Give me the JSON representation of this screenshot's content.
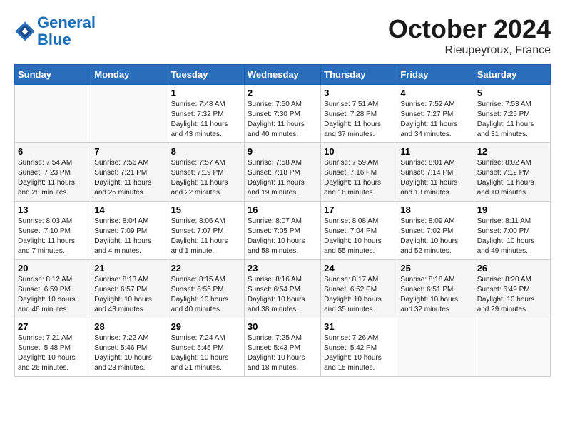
{
  "header": {
    "logo_line1": "General",
    "logo_line2": "Blue",
    "month": "October 2024",
    "location": "Rieupeyroux, France"
  },
  "weekdays": [
    "Sunday",
    "Monday",
    "Tuesday",
    "Wednesday",
    "Thursday",
    "Friday",
    "Saturday"
  ],
  "weeks": [
    [
      {
        "day": "",
        "sunrise": "",
        "sunset": "",
        "daylight": ""
      },
      {
        "day": "",
        "sunrise": "",
        "sunset": "",
        "daylight": ""
      },
      {
        "day": "1",
        "sunrise": "Sunrise: 7:48 AM",
        "sunset": "Sunset: 7:32 PM",
        "daylight": "Daylight: 11 hours and 43 minutes."
      },
      {
        "day": "2",
        "sunrise": "Sunrise: 7:50 AM",
        "sunset": "Sunset: 7:30 PM",
        "daylight": "Daylight: 11 hours and 40 minutes."
      },
      {
        "day": "3",
        "sunrise": "Sunrise: 7:51 AM",
        "sunset": "Sunset: 7:28 PM",
        "daylight": "Daylight: 11 hours and 37 minutes."
      },
      {
        "day": "4",
        "sunrise": "Sunrise: 7:52 AM",
        "sunset": "Sunset: 7:27 PM",
        "daylight": "Daylight: 11 hours and 34 minutes."
      },
      {
        "day": "5",
        "sunrise": "Sunrise: 7:53 AM",
        "sunset": "Sunset: 7:25 PM",
        "daylight": "Daylight: 11 hours and 31 minutes."
      }
    ],
    [
      {
        "day": "6",
        "sunrise": "Sunrise: 7:54 AM",
        "sunset": "Sunset: 7:23 PM",
        "daylight": "Daylight: 11 hours and 28 minutes."
      },
      {
        "day": "7",
        "sunrise": "Sunrise: 7:56 AM",
        "sunset": "Sunset: 7:21 PM",
        "daylight": "Daylight: 11 hours and 25 minutes."
      },
      {
        "day": "8",
        "sunrise": "Sunrise: 7:57 AM",
        "sunset": "Sunset: 7:19 PM",
        "daylight": "Daylight: 11 hours and 22 minutes."
      },
      {
        "day": "9",
        "sunrise": "Sunrise: 7:58 AM",
        "sunset": "Sunset: 7:18 PM",
        "daylight": "Daylight: 11 hours and 19 minutes."
      },
      {
        "day": "10",
        "sunrise": "Sunrise: 7:59 AM",
        "sunset": "Sunset: 7:16 PM",
        "daylight": "Daylight: 11 hours and 16 minutes."
      },
      {
        "day": "11",
        "sunrise": "Sunrise: 8:01 AM",
        "sunset": "Sunset: 7:14 PM",
        "daylight": "Daylight: 11 hours and 13 minutes."
      },
      {
        "day": "12",
        "sunrise": "Sunrise: 8:02 AM",
        "sunset": "Sunset: 7:12 PM",
        "daylight": "Daylight: 11 hours and 10 minutes."
      }
    ],
    [
      {
        "day": "13",
        "sunrise": "Sunrise: 8:03 AM",
        "sunset": "Sunset: 7:10 PM",
        "daylight": "Daylight: 11 hours and 7 minutes."
      },
      {
        "day": "14",
        "sunrise": "Sunrise: 8:04 AM",
        "sunset": "Sunset: 7:09 PM",
        "daylight": "Daylight: 11 hours and 4 minutes."
      },
      {
        "day": "15",
        "sunrise": "Sunrise: 8:06 AM",
        "sunset": "Sunset: 7:07 PM",
        "daylight": "Daylight: 11 hours and 1 minute."
      },
      {
        "day": "16",
        "sunrise": "Sunrise: 8:07 AM",
        "sunset": "Sunset: 7:05 PM",
        "daylight": "Daylight: 10 hours and 58 minutes."
      },
      {
        "day": "17",
        "sunrise": "Sunrise: 8:08 AM",
        "sunset": "Sunset: 7:04 PM",
        "daylight": "Daylight: 10 hours and 55 minutes."
      },
      {
        "day": "18",
        "sunrise": "Sunrise: 8:09 AM",
        "sunset": "Sunset: 7:02 PM",
        "daylight": "Daylight: 10 hours and 52 minutes."
      },
      {
        "day": "19",
        "sunrise": "Sunrise: 8:11 AM",
        "sunset": "Sunset: 7:00 PM",
        "daylight": "Daylight: 10 hours and 49 minutes."
      }
    ],
    [
      {
        "day": "20",
        "sunrise": "Sunrise: 8:12 AM",
        "sunset": "Sunset: 6:59 PM",
        "daylight": "Daylight: 10 hours and 46 minutes."
      },
      {
        "day": "21",
        "sunrise": "Sunrise: 8:13 AM",
        "sunset": "Sunset: 6:57 PM",
        "daylight": "Daylight: 10 hours and 43 minutes."
      },
      {
        "day": "22",
        "sunrise": "Sunrise: 8:15 AM",
        "sunset": "Sunset: 6:55 PM",
        "daylight": "Daylight: 10 hours and 40 minutes."
      },
      {
        "day": "23",
        "sunrise": "Sunrise: 8:16 AM",
        "sunset": "Sunset: 6:54 PM",
        "daylight": "Daylight: 10 hours and 38 minutes."
      },
      {
        "day": "24",
        "sunrise": "Sunrise: 8:17 AM",
        "sunset": "Sunset: 6:52 PM",
        "daylight": "Daylight: 10 hours and 35 minutes."
      },
      {
        "day": "25",
        "sunrise": "Sunrise: 8:18 AM",
        "sunset": "Sunset: 6:51 PM",
        "daylight": "Daylight: 10 hours and 32 minutes."
      },
      {
        "day": "26",
        "sunrise": "Sunrise: 8:20 AM",
        "sunset": "Sunset: 6:49 PM",
        "daylight": "Daylight: 10 hours and 29 minutes."
      }
    ],
    [
      {
        "day": "27",
        "sunrise": "Sunrise: 7:21 AM",
        "sunset": "Sunset: 5:48 PM",
        "daylight": "Daylight: 10 hours and 26 minutes."
      },
      {
        "day": "28",
        "sunrise": "Sunrise: 7:22 AM",
        "sunset": "Sunset: 5:46 PM",
        "daylight": "Daylight: 10 hours and 23 minutes."
      },
      {
        "day": "29",
        "sunrise": "Sunrise: 7:24 AM",
        "sunset": "Sunset: 5:45 PM",
        "daylight": "Daylight: 10 hours and 21 minutes."
      },
      {
        "day": "30",
        "sunrise": "Sunrise: 7:25 AM",
        "sunset": "Sunset: 5:43 PM",
        "daylight": "Daylight: 10 hours and 18 minutes."
      },
      {
        "day": "31",
        "sunrise": "Sunrise: 7:26 AM",
        "sunset": "Sunset: 5:42 PM",
        "daylight": "Daylight: 10 hours and 15 minutes."
      },
      {
        "day": "",
        "sunrise": "",
        "sunset": "",
        "daylight": ""
      },
      {
        "day": "",
        "sunrise": "",
        "sunset": "",
        "daylight": ""
      }
    ]
  ]
}
